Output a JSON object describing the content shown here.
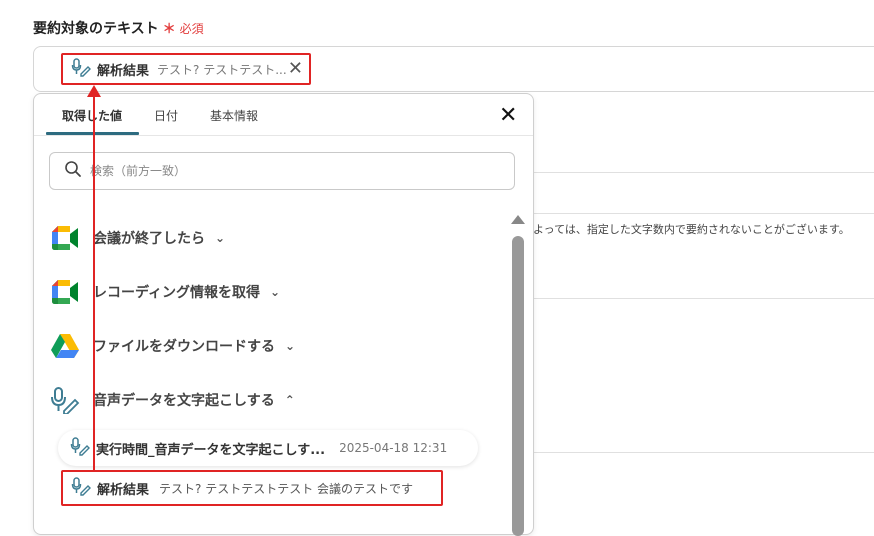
{
  "field": {
    "label": "要約対象のテキスト",
    "asterisk": "＊",
    "required": "必須"
  },
  "chip": {
    "label": "解析結果",
    "value": "テスト? テストテスト...",
    "remove": "✕"
  },
  "background_note": "よっては、指定した文字数内で要約されないことがございます。",
  "popup": {
    "tabs": [
      "取得した値",
      "日付",
      "基本情報"
    ],
    "active_tab": 0,
    "close": "✕",
    "search_placeholder": "検索（前方一致）",
    "groups": [
      {
        "label": "会議が終了したら",
        "icon": "google-meet-icon",
        "chevron": "⌄"
      },
      {
        "label": "レコーディング情報を取得",
        "icon": "google-meet-icon",
        "chevron": "⌄"
      },
      {
        "label": "ファイルをダウンロードする",
        "icon": "google-drive-icon",
        "chevron": "⌄"
      },
      {
        "label": "音声データを文字起こしする",
        "icon": "mic-pen-icon",
        "chevron": "⌃"
      }
    ],
    "items": [
      {
        "name": "実行時間_音声データを文字起こしす...",
        "value": "2025-04-18 12:31"
      },
      {
        "name": "解析結果",
        "value": "テスト? テストテストテスト 会議のテストです"
      }
    ]
  },
  "colors": {
    "highlight": "#e02424",
    "tab_underline": "#2d6b80",
    "required": "#e23d3d"
  }
}
